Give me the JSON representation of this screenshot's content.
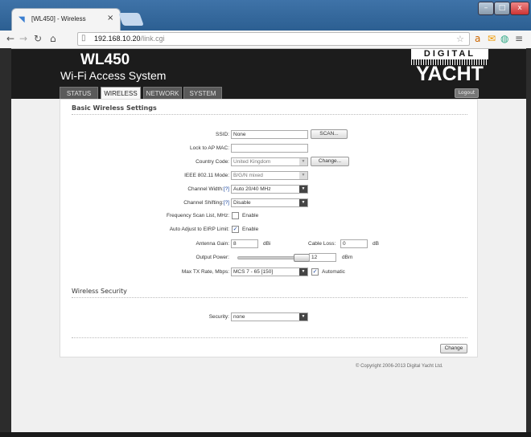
{
  "browser": {
    "tab_title": "[WL450] - Wireless",
    "tab_close": "×",
    "url_host": "192.168.10.20",
    "url_path": "/link.cgi",
    "min": "–",
    "max": "□",
    "close": "x"
  },
  "header": {
    "brand": "WL450",
    "subtitle": "Wi-Fi Access System",
    "logo_top": "DIGITAL",
    "logo_main": "YACHT",
    "logout": "Logout"
  },
  "nav": {
    "tabs": [
      "STATUS",
      "WIRELESS",
      "NETWORK",
      "SYSTEM"
    ],
    "active": "WIRELESS"
  },
  "basic": {
    "title": "Basic Wireless Settings",
    "ssid_label": "SSID:",
    "ssid_value": "None",
    "scan_button": "SCAN...",
    "lock_ap_label": "Lock to AP MAC:",
    "lock_ap_value": "",
    "country_label": "Country Code:",
    "country_value": "United Kingdom",
    "change_button": "Change...",
    "mode_label": "IEEE 802.11 Mode:",
    "mode_value": "B/G/N mixed",
    "width_label": "Channel Width:",
    "width_help": "[?]",
    "width_value": "Auto 20/40 MHz",
    "shift_label": "Channel Shifting:",
    "shift_help": "[?]",
    "shift_value": "Disable",
    "freq_label": "Frequency Scan List, MHz:",
    "freq_enable": "Enable",
    "freq_checked": false,
    "eirp_label": "Auto Adjust to EIRP Limit:",
    "eirp_enable": "Enable",
    "eirp_checked": true,
    "gain_label": "Antenna Gain:",
    "gain_value": "8",
    "gain_unit": "dBi",
    "loss_label": "Cable Loss:",
    "loss_value": "0",
    "loss_unit": "dB",
    "power_label": "Output Power:",
    "power_value": "12",
    "power_unit": "dBm",
    "power_fraction": 0.95,
    "rate_label": "Max TX Rate, Mbps:",
    "rate_value": "MCS 7 - 65 [150]",
    "rate_auto": "Automatic",
    "rate_auto_checked": true
  },
  "security": {
    "title": "Wireless Security",
    "label": "Security:",
    "value": "none"
  },
  "footer": {
    "change_button": "Change",
    "copyright": "© Copyright 2006-2013 Digital Yacht Ltd."
  },
  "colors": {
    "header_bg": "#1c1c1c",
    "chrome_blue": "#3f73a8"
  }
}
